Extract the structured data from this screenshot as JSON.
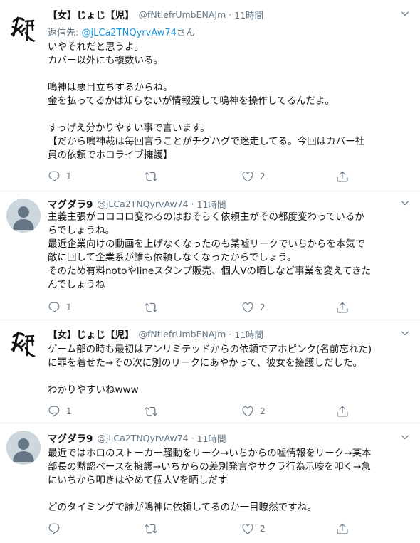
{
  "tweets": [
    {
      "name": "【女】じょじ【児】",
      "handle": "@fNtlefrUmbENAJm",
      "dot": "·",
      "time": "11時間",
      "reply_label": "返信先: ",
      "reply_handle": "@jLCa2TNQyrvAw74",
      "reply_suffix": "さん",
      "lines": [
        "いやそれだと思うよ。",
        "カバー以外にも複数いる。",
        "",
        "鳴神は悪目立ちするからね。",
        "金を払ってるかは知らないが情報渡して鳴神を操作してるんだよ。",
        "",
        "すっげえ分かりやすい事で言います。",
        "【だから鳴神裁は毎回言うことがチグハグで迷走してる。今回はカバー社",
        "員の依頼でホロライブ擁護】"
      ],
      "reply_count": "1",
      "retweet_count": "",
      "like_count": "2"
    },
    {
      "name": "マグダラ9",
      "handle": "@jLCa2TNQyrvAw74",
      "dot": "·",
      "time": "11時間",
      "lines": [
        "主義主張がコロコロ変わるのはおそらく依頼主がその都度変わっているか",
        "らでしょうね。",
        "最近企業向けの動画を上げなくなったのも某嘘リークでいちからを本気で",
        "敵に回して企業系が誰も依頼しなくなったからでしょう。",
        "そのため有料notoやlineスタンプ販売、個人Vの晒しなど事業を変えてきた",
        "んでしょうね"
      ],
      "reply_count": "1",
      "retweet_count": "",
      "like_count": "2"
    },
    {
      "name": "【女】じょじ【児】",
      "handle": "@fNtlefrUmbENAJm",
      "dot": "·",
      "time": "11時間",
      "lines": [
        "ゲーム部の時も最初はアンリミテッドからの依頼でアホピンク(名前忘れた)",
        "に罪を着せた→その次に別のリークにあやかって、彼女を擁護しだした。",
        "",
        "わかりやすいねwww"
      ],
      "reply_count": "1",
      "retweet_count": "",
      "like_count": "2"
    },
    {
      "name": "マグダラ9",
      "handle": "@jLCa2TNQyrvAw74",
      "dot": "·",
      "time": "11時間",
      "lines": [
        "最近ではホロのストーカー騒動をリーク→いちからの嘘情報をリーク→某本",
        "部長の黙認ベースを擁護→いちからの差別発言やサクラ行為示唆を叩く→急",
        "にいちから叩きはやめて個人Vを晒しだす",
        "",
        "どのタイミングで誰が鳴神に依頼してるのか一目瞭然ですね。"
      ],
      "reply_count": "",
      "retweet_count": "",
      "like_count": "2"
    }
  ],
  "icons": [
    "chevron-down-icon",
    "reply-icon",
    "retweet-icon",
    "like-icon",
    "share-icon",
    "kanji-avatar",
    "default-avatar"
  ],
  "colors": {
    "text": "#14171a",
    "secondary": "#657786",
    "link": "#1b95e0",
    "divider": "#e6ecf0",
    "avatar_default": "#ccd6dd"
  }
}
